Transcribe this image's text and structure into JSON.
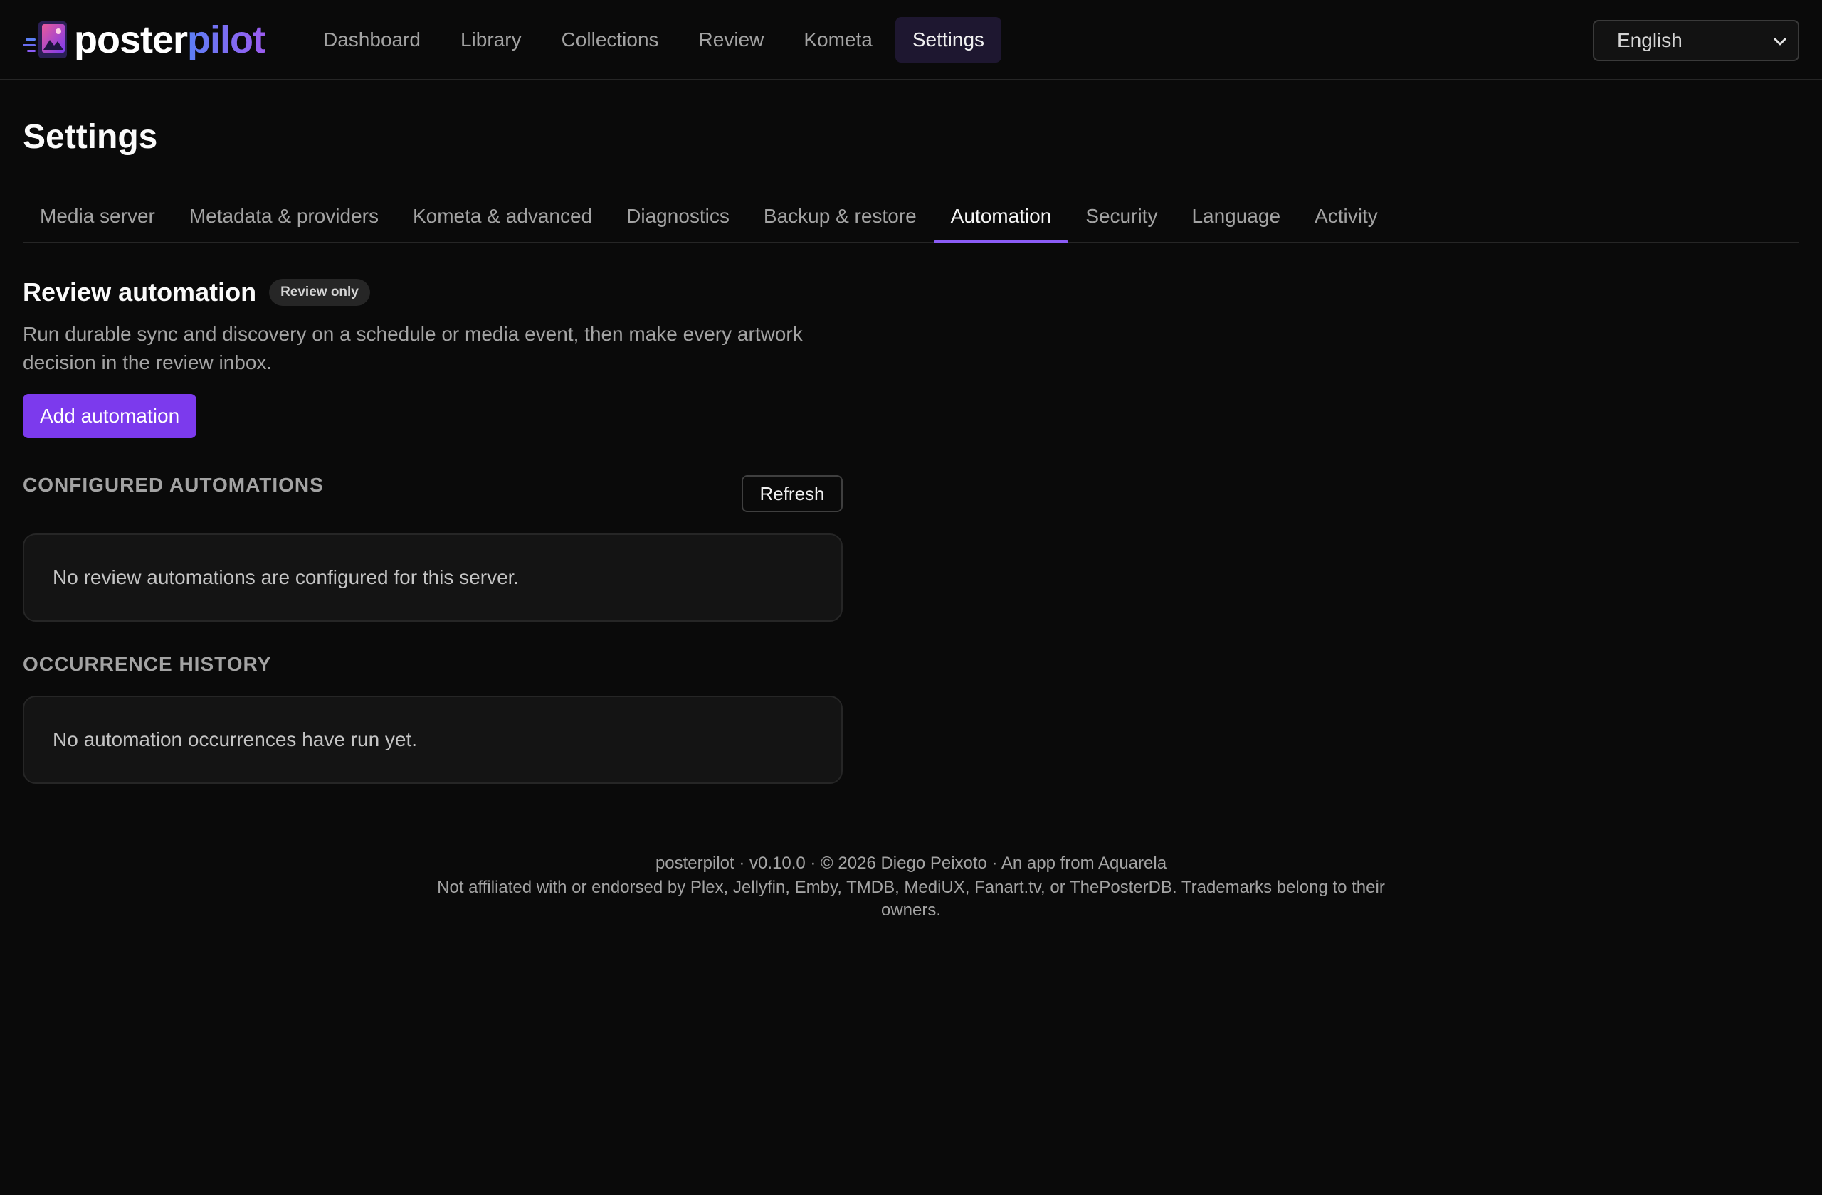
{
  "app": {
    "logo_part1": "poster",
    "logo_part2": "pilot"
  },
  "nav": {
    "items": [
      {
        "label": "Dashboard"
      },
      {
        "label": "Library"
      },
      {
        "label": "Collections"
      },
      {
        "label": "Review"
      },
      {
        "label": "Kometa"
      },
      {
        "label": "Settings",
        "active": true
      }
    ]
  },
  "language_select": {
    "value": "English"
  },
  "page": {
    "title": "Settings"
  },
  "tabs": [
    {
      "label": "Media server"
    },
    {
      "label": "Metadata & providers"
    },
    {
      "label": "Kometa & advanced"
    },
    {
      "label": "Diagnostics"
    },
    {
      "label": "Backup & restore"
    },
    {
      "label": "Automation",
      "active": true
    },
    {
      "label": "Security"
    },
    {
      "label": "Language"
    },
    {
      "label": "Activity"
    }
  ],
  "automation": {
    "title": "Review automation",
    "badge": "Review only",
    "description": "Run durable sync and discovery on a schedule or media event, then make every artwork decision in the review inbox.",
    "add_button": "Add automation",
    "configured_heading": "CONFIGURED AUTOMATIONS",
    "refresh_button": "Refresh",
    "configured_empty": "No review automations are configured for this server.",
    "history_heading": "OCCURRENCE HISTORY",
    "history_empty": "No automation occurrences have run yet."
  },
  "footer": {
    "line1": "posterpilot · v0.10.0 · © 2026 Diego Peixoto · An app from Aquarela",
    "line2": "Not affiliated with or endorsed by Plex, Jellyfin, Emby, TMDB, MediUX, Fanart.tv, or ThePosterDB. Trademarks belong to their owners."
  },
  "colors": {
    "background": "#0a0a0a",
    "accent": "#7c3aed",
    "tab_indicator": "#8b5cf6",
    "nav_active_bg": "#1e1730"
  },
  "icons": {
    "logo": "posterpilot-logo-icon",
    "select_chevron": "chevron-down-icon"
  }
}
